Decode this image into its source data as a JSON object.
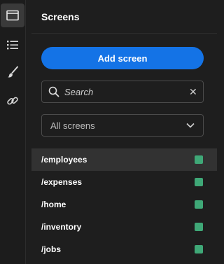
{
  "rail": {
    "items": [
      {
        "icon": "window-icon",
        "active": true
      },
      {
        "icon": "list-icon",
        "active": false
      },
      {
        "icon": "paint-brush-icon",
        "active": false
      },
      {
        "icon": "link-icon",
        "active": false
      }
    ]
  },
  "panel": {
    "title": "Screens",
    "add_button_label": "Add screen",
    "search": {
      "placeholder": "Search",
      "value": ""
    },
    "filter": {
      "selected": "All screens"
    }
  },
  "screens": [
    {
      "label": "/employees",
      "selected": true
    },
    {
      "label": "/expenses",
      "selected": false
    },
    {
      "label": "/home",
      "selected": false
    },
    {
      "label": "/inventory",
      "selected": false
    },
    {
      "label": "/jobs",
      "selected": false
    }
  ],
  "colors": {
    "accent": "#1473e6",
    "status": "#3fa877"
  }
}
